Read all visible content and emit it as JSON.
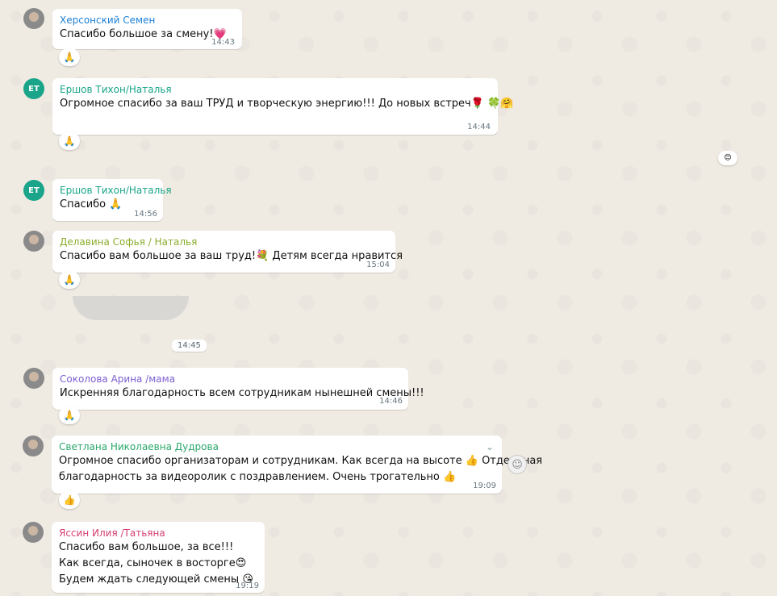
{
  "messages": [
    {
      "sender": "Херсонский Семен",
      "sender_color": "#1c7fd6",
      "text_lines": [
        "Спасибо большое за смену!💗"
      ],
      "time": "14:43",
      "reaction": "🙏"
    },
    {
      "sender": "Ершов Тихон/Наталья",
      "sender_color": "#1aa58a",
      "avatar_initials": "ЕТ",
      "text_lines": [
        "Огромное спасибо за ваш ТРУД и творческую энергию!!! До новых встреч🌹 🍀🤗"
      ],
      "time": "14:44",
      "reaction": "🙏"
    },
    {
      "sender": "Ершов Тихон/Наталья",
      "sender_color": "#1aa58a",
      "avatar_initials": "ЕТ",
      "text_lines": [
        "Спасибо 🙏"
      ],
      "time": "14:56"
    },
    {
      "sender": "Делавина Софья / Наталья",
      "sender_color": "#8bae2c",
      "text_lines": [
        "Спасибо вам большое за ваш труд!💐 Детям всегда нравится"
      ],
      "time": "15:04",
      "reaction": "🙏"
    },
    {
      "sender": "Соколова Арина /мама",
      "sender_color": "#7c5fd1",
      "text_lines": [
        "Искренняя благодарность всем сотрудникам нынешней смены!!!"
      ],
      "time": "14:46",
      "reaction": "🙏"
    },
    {
      "sender": "Светлана Николаевна Дудрова",
      "sender_color": "#2aa86b",
      "text_lines": [
        "Огромное спасибо организаторам и сотрудникам. Как всегда на высоте 👍 Отдельная",
        "благодарность за видеоролик с поздравлением. Очень трогательно 👍"
      ],
      "time": "19:09",
      "reaction": "👍"
    },
    {
      "sender": "Яссин Илия /Татьяна",
      "sender_color": "#d63f6f",
      "text_lines": [
        "Спасибо вам большое, за все!!!",
        "Как всегда, сыночек в восторге😍",
        "Будем ждать следующей смены 😘"
      ],
      "time": "19:19"
    }
  ],
  "separator_time": "14:45",
  "colors": {
    "background": "#efeae2",
    "bubble": "#ffffff",
    "time": "#667781"
  },
  "icons": {
    "dropdown": "chevron-down-icon",
    "side": "emoji-icon"
  }
}
